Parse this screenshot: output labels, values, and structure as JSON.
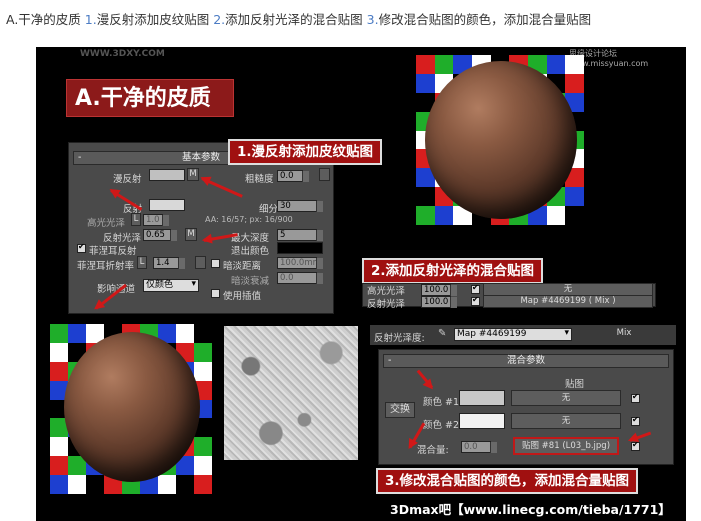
{
  "caption": {
    "part_a": "A.干净的皮质",
    "n1": "1.",
    "part_1": "漫反射添加皮纹贴图",
    "n2": "2.",
    "part_2": "添加反射光泽的混合贴图",
    "n3": "3.",
    "part_3": "修改混合贴图的颜色，添加混合量贴图"
  },
  "watermarks": {
    "top_left": "WWW.3DXY.COM",
    "top_right": "思缘设计论坛",
    "top_right_small": "www.missyuan.com"
  },
  "labels": {
    "title_a": "A.干净的皮质",
    "step1": "1.漫反射添加皮纹贴图",
    "step2": "2.添加反射光泽的混合贴图",
    "step3": "3.修改混合贴图的颜色，添加混合量贴图"
  },
  "basic_params": {
    "header": "基本参数",
    "diffuse_label": "漫反射",
    "m_button": "M",
    "roughness_label": "粗糙度",
    "roughness_value": "0.0",
    "reflect_label": "反射",
    "subdivs_label": "细分",
    "subdivs_value": "30",
    "hilight_label": "高光光泽",
    "l_button": "L",
    "hilight_value": "1.0",
    "aa_info": "AA: 16/57; px: 16/900",
    "refl_gloss_label": "反射光泽",
    "refl_gloss_value": "0.65",
    "max_depth_label": "最大深度",
    "max_depth_value": "5",
    "exit_color_label": "退出颜色",
    "fresnel_label": "菲涅耳反射",
    "fresnel_ior_label": "菲涅耳折射率",
    "fresnel_ior_value": "1.4",
    "dim_dist_label": "暗淡距离",
    "dim_dist_value": "100.0mm",
    "dim_falloff_label": "暗淡衰减",
    "dim_falloff_value": "0.0",
    "affect_channels_label": "影响通道",
    "affect_channels_value": "仅颜色",
    "use_interp_label": "使用插值"
  },
  "reflect_rows": {
    "hilight_label": "高光光泽",
    "hilight_value": "100.0",
    "hilight_map": "无",
    "refl_label": "反射光泽",
    "refl_value": "100.0",
    "refl_map": "Map #4469199  ( Mix )"
  },
  "mix_panel": {
    "gloss_label": "反射光泽度:",
    "map_name": "Map #4469199",
    "map_type": "Mix",
    "header": "混合参数",
    "maps_header": "贴图",
    "swap_button": "交换",
    "color1_label": "颜色 #1",
    "color1_map": "无",
    "color2_label": "颜色 #2",
    "color2_map": "无",
    "mix_amount_label": "混合量:",
    "mix_amount_value": "0.0",
    "mix_map": "贴图 #81 (L03_b.jpg)"
  },
  "footer": "3Dmax吧【www.linecg.com/tieba/1771】",
  "colors": {
    "accent_red": "#a01010",
    "arrow_red": "#d01818",
    "panel_gray": "#4a4a4a",
    "stage_black": "#000000",
    "caption_blue": "#4c7cc4"
  }
}
